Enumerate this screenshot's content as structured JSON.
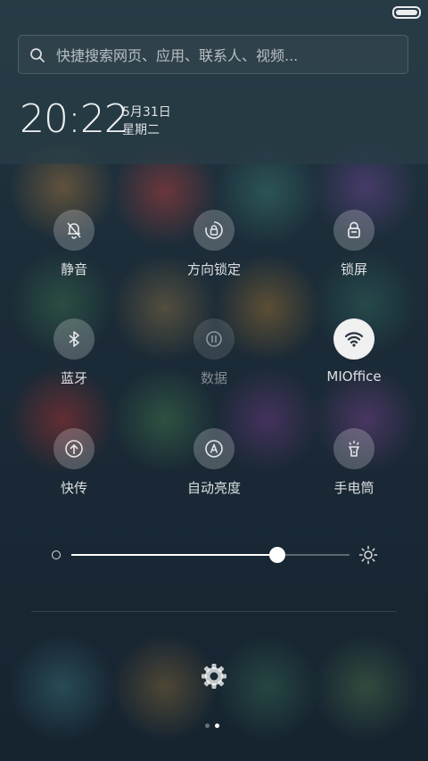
{
  "search": {
    "placeholder": "快捷搜索网页、应用、联系人、视频..."
  },
  "clock": {
    "time": "20:22",
    "date": "5月31日",
    "weekday": "星期二"
  },
  "toggles": [
    {
      "label": "静音",
      "icon": "bell-off-icon",
      "state": "off"
    },
    {
      "label": "方向锁定",
      "icon": "rotation-lock-icon",
      "state": "off"
    },
    {
      "label": "锁屏",
      "icon": "lock-icon",
      "state": "off"
    },
    {
      "label": "蓝牙",
      "icon": "bluetooth-icon",
      "state": "off"
    },
    {
      "label": "数据",
      "icon": "mobile-data-icon",
      "state": "disabled"
    },
    {
      "label": "MIOffice",
      "icon": "wifi-icon",
      "state": "on"
    },
    {
      "label": "快传",
      "icon": "quick-transfer-icon",
      "state": "off"
    },
    {
      "label": "自动亮度",
      "icon": "auto-brightness-icon",
      "state": "off"
    },
    {
      "label": "手电筒",
      "icon": "flashlight-icon",
      "state": "off"
    }
  ],
  "brightness": {
    "level": 0.74
  },
  "pager": {
    "pages": 2,
    "current": 2
  },
  "colors": {
    "active_tile": "#f0f0f0",
    "inactive_tile": "rgba(255,255,255,0.22)",
    "text": "#ffffff"
  }
}
